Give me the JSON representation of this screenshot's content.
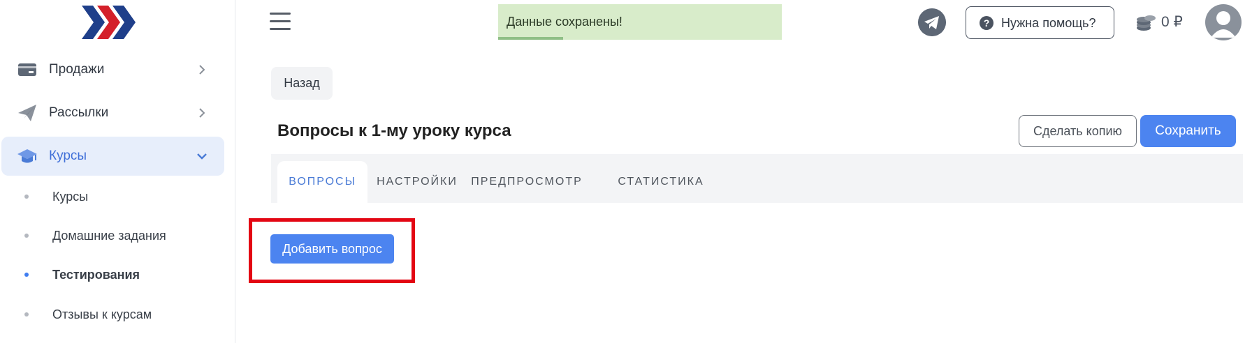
{
  "sidebar": {
    "menu": [
      {
        "label": "Продажи",
        "icon": "card-icon"
      },
      {
        "label": "Рассылки",
        "icon": "paper-plane-icon"
      },
      {
        "label": "Курсы",
        "icon": "graduation-cap-icon",
        "active": true
      }
    ],
    "sub_items": [
      {
        "label": "Курсы"
      },
      {
        "label": "Домашние задания"
      },
      {
        "label": "Тестирования",
        "current": true
      },
      {
        "label": "Отзывы к курсам"
      }
    ]
  },
  "header": {
    "toast": "Данные сохранены!",
    "toast_progress": 0.23,
    "help_label": "Нужна помощь?",
    "balance": "0 ₽"
  },
  "main": {
    "back_label": "Назад",
    "title": "Вопросы к 1-му уроку курса",
    "copy_label": "Сделать копию",
    "save_label": "Сохранить",
    "tabs": [
      {
        "label": "Вопросы",
        "active": true
      },
      {
        "label": "Настройки"
      },
      {
        "label": "Предпросмотр"
      },
      {
        "label": "Статистика"
      }
    ],
    "add_question_label": "Добавить вопрос"
  },
  "colors": {
    "accent": "#4c84f0",
    "active_menu_bg": "#e7eefb",
    "toast_bg": "#d8ecca",
    "highlight_frame": "#e30613"
  }
}
